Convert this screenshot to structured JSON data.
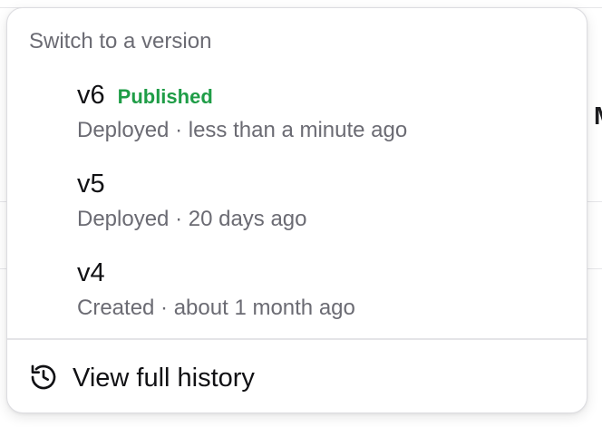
{
  "popover": {
    "header": "Switch to a version",
    "versions": [
      {
        "name": "v6",
        "badge": "Published",
        "meta": "Deployed · less than a minute ago"
      },
      {
        "name": "v5",
        "badge": "",
        "meta": "Deployed · 20 days ago"
      },
      {
        "name": "v4",
        "badge": "",
        "meta": "Created · about 1 month ago"
      }
    ],
    "history_label": "View full history",
    "history_icon": "history-icon"
  },
  "background": {
    "partial_glyph": "M"
  },
  "colors": {
    "badge_published": "#1f9d47",
    "muted_text": "#6b6b73",
    "primary_text": "#111114"
  }
}
